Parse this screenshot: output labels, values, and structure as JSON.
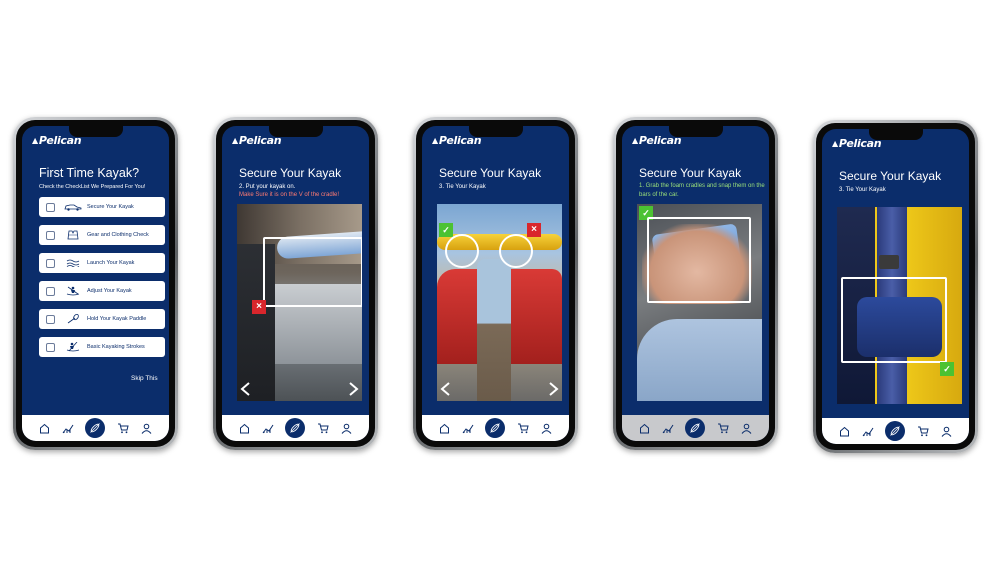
{
  "brand": {
    "name": "Pelican",
    "primary": "#0b2d6b",
    "success": "#4cc232",
    "danger": "#d9262c"
  },
  "screens": [
    {
      "title": "First Time Kayak?",
      "subtitle": "Check the CheckList We Prepared For You!",
      "checklist": [
        {
          "label": "Secure Your Kayak",
          "icon": "car-icon"
        },
        {
          "label": "Gear and Clothing Check",
          "icon": "life-vest-icon"
        },
        {
          "label": "Launch Your Kayak",
          "icon": "water-waves-icon"
        },
        {
          "label": "Adjust Your Kayak",
          "icon": "kayaker-icon"
        },
        {
          "label": "Hold Your Kayak Paddle",
          "icon": "paddle-icon"
        },
        {
          "label": "Basic Kayaking Strokes",
          "icon": "kayaker-icon"
        }
      ],
      "skip": "Skip This"
    },
    {
      "title": "Secure Your Kayak",
      "step": "2. Put your kayak on.",
      "warning": "Make Sure it is on the V of the cradle!"
    },
    {
      "title": "Secure Your Kayak",
      "step": "3. Tie Your Kayak"
    },
    {
      "title": "Secure Your Kayak",
      "step": "1. Grab the foam cradles and snap them on the bars of the car."
    },
    {
      "title": "Secure Your Kayak",
      "step": "3. Tie Your Kayak"
    }
  ],
  "nav": [
    "home-icon",
    "stats-icon",
    "kayak-center-icon",
    "cart-icon",
    "profile-icon"
  ]
}
